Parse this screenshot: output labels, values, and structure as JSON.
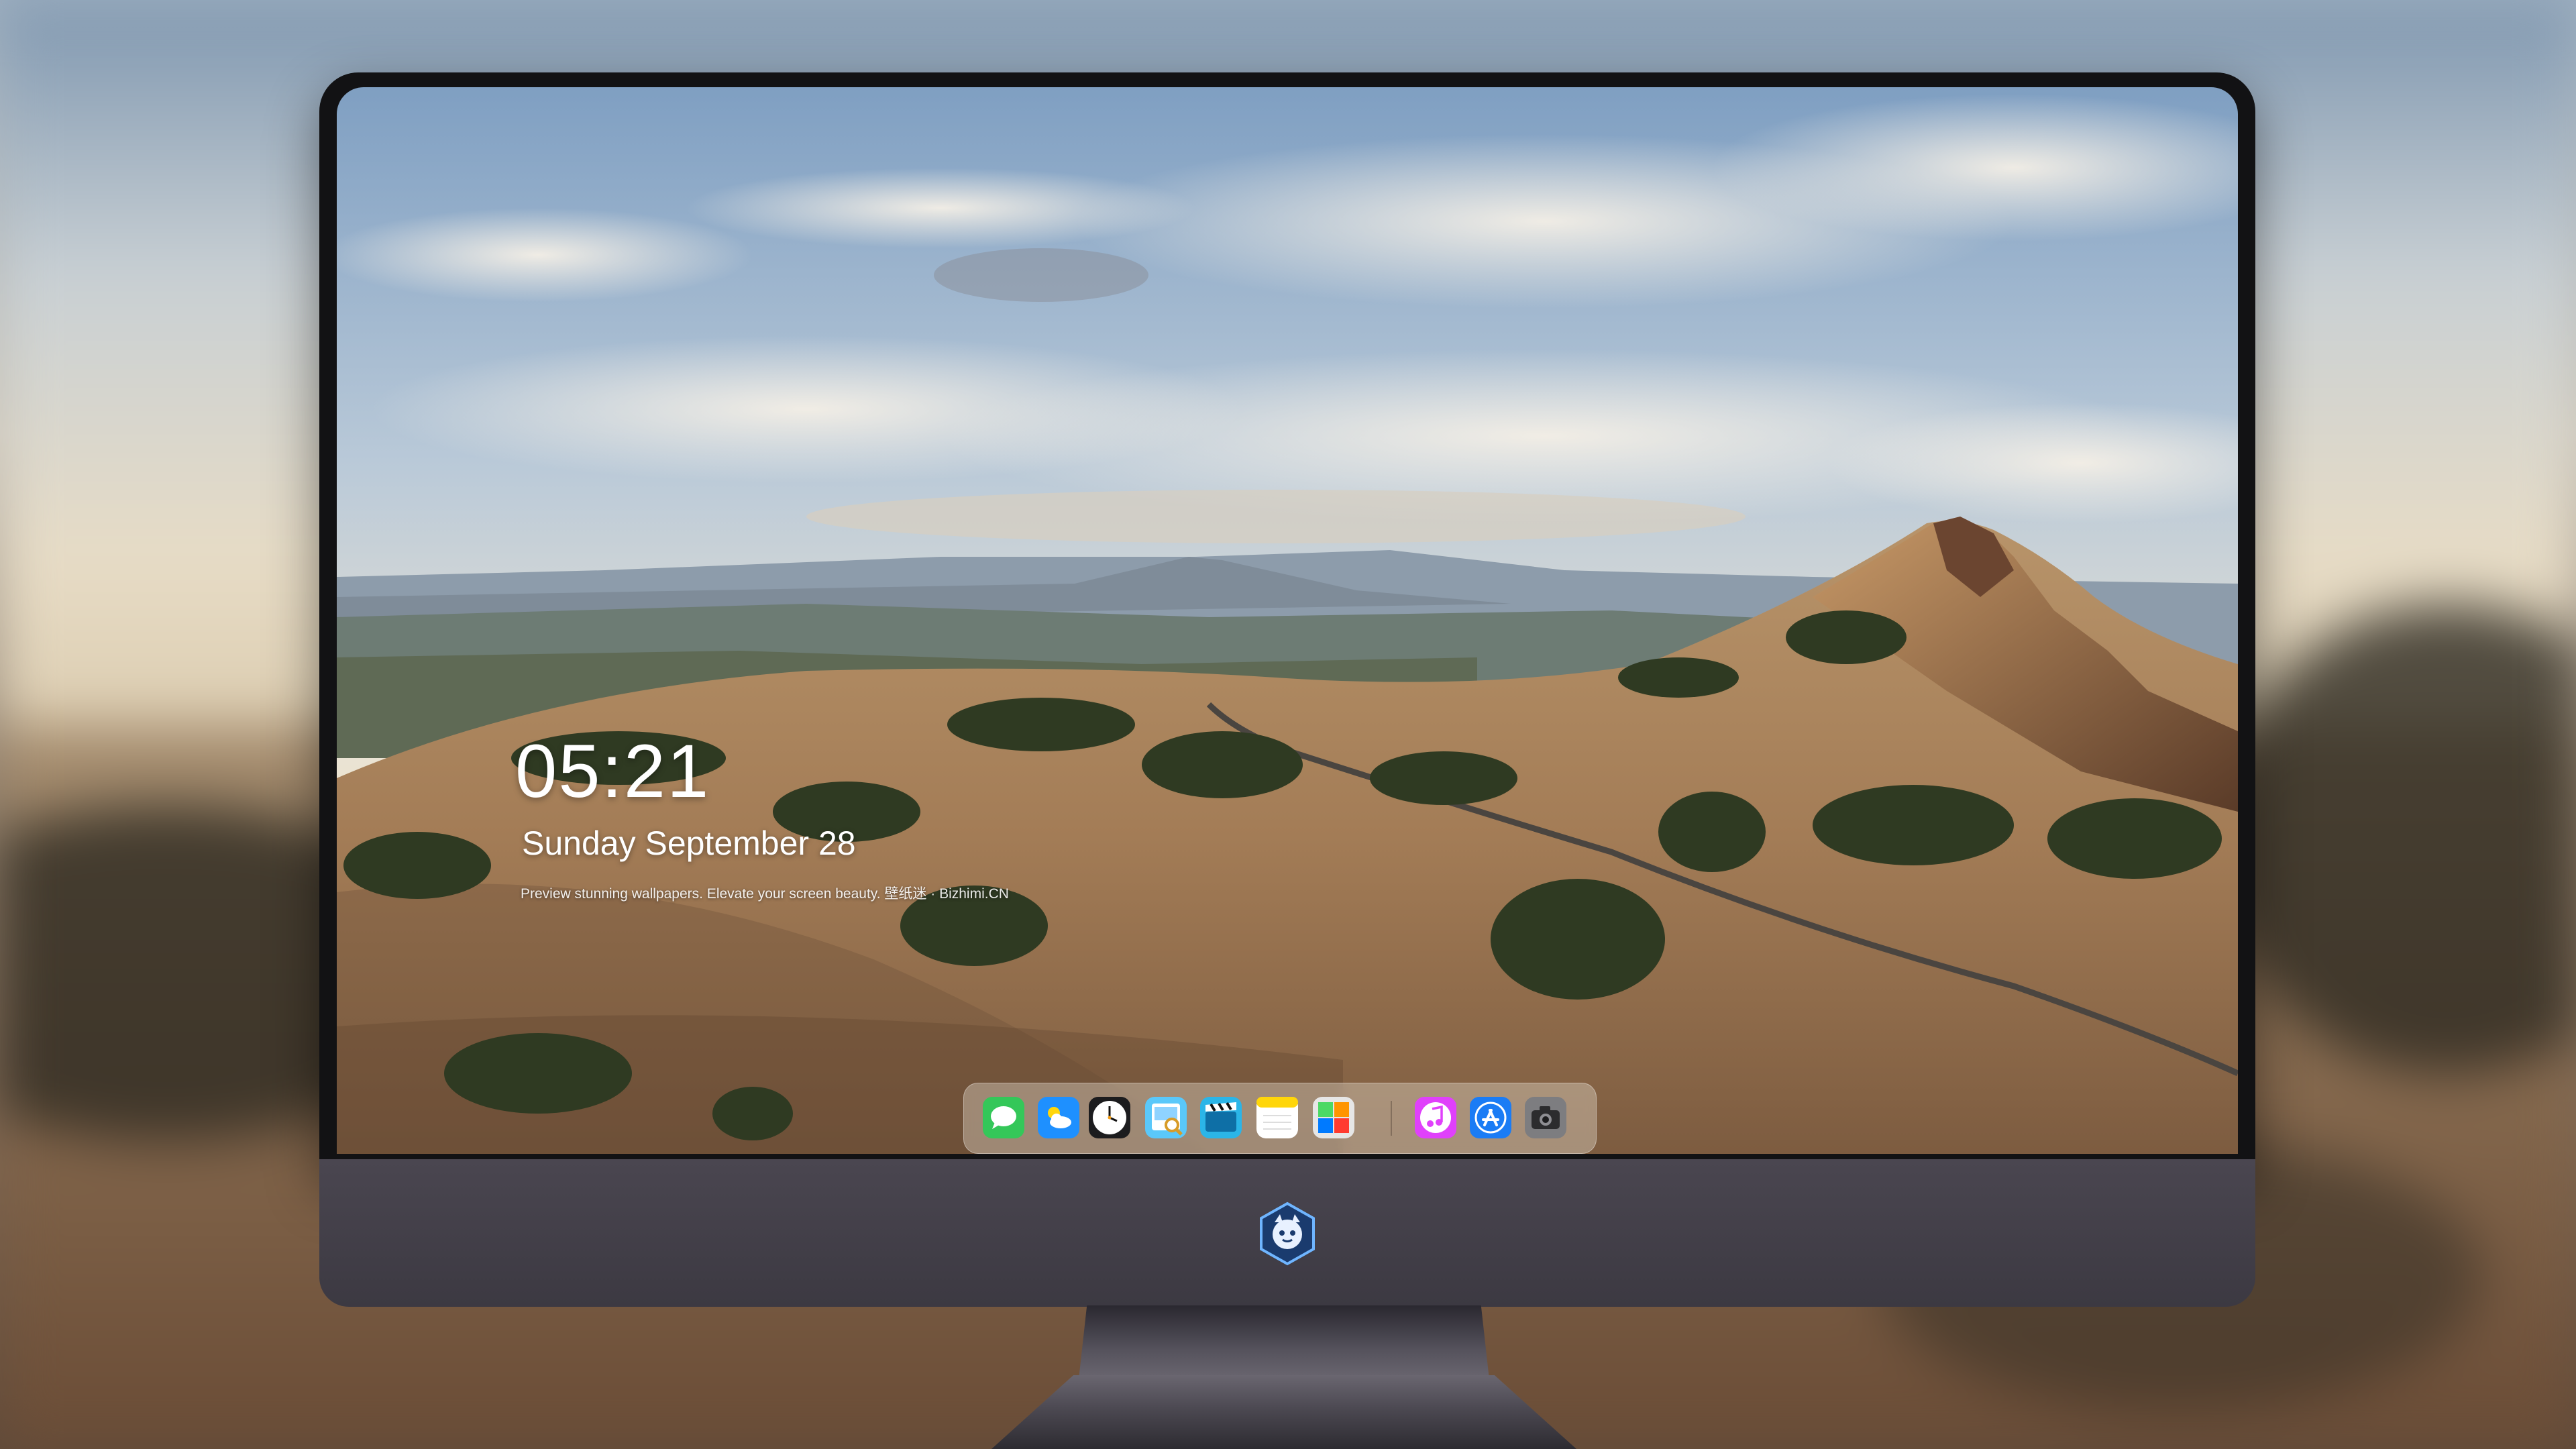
{
  "lockscreen": {
    "time": "05:21",
    "date": "Sunday September  28",
    "caption": "Preview stunning wallpapers. Elevate your screen beauty. 壁纸迷 · Bizhimi.CN"
  },
  "dock": {
    "apps": [
      {
        "name": "messages-icon",
        "color": "#34c759"
      },
      {
        "name": "weather-icon",
        "color": "#1e90ff"
      },
      {
        "name": "clock-icon",
        "color": "#1c1c1e"
      },
      {
        "name": "preview-icon",
        "color": "#5ac8fa"
      },
      {
        "name": "clips-icon",
        "color": "#2bb5e8"
      },
      {
        "name": "notes-icon",
        "color": "#ffd60a"
      },
      {
        "name": "photo-booth-icon",
        "color": "#e6e6e6"
      },
      {
        "name": "music-icon",
        "color": "#e040fb"
      },
      {
        "name": "app-store-icon",
        "color": "#1a7cf5"
      },
      {
        "name": "camera-icon",
        "color": "#7d7d80"
      }
    ]
  },
  "monitor": {
    "logo": "mascot-logo-icon"
  }
}
